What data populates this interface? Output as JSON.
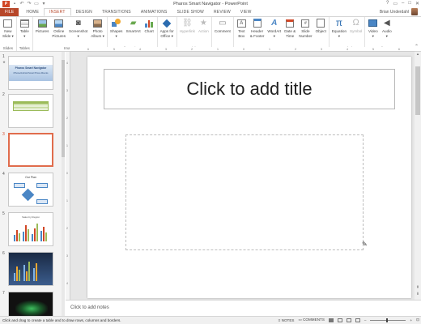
{
  "window": {
    "title": "Pharos Smart Navigator - PowerPoint",
    "app_icon": "P",
    "controls": [
      "?",
      "▭",
      "–",
      "□",
      "✕"
    ]
  },
  "qat": {
    "icons": [
      "save-icon",
      "undo-icon",
      "redo-icon",
      "start-slideshow-icon",
      "customize-qat-icon"
    ]
  },
  "tabs": [
    {
      "label": "FILE"
    },
    {
      "label": "HOME"
    },
    {
      "label": "INSERT"
    },
    {
      "label": "DESIGN"
    },
    {
      "label": "TRANSITIONS"
    },
    {
      "label": "ANIMATIONS"
    },
    {
      "label": "SLIDE SHOW"
    },
    {
      "label": "REVIEW"
    },
    {
      "label": "VIEW"
    }
  ],
  "active_tab": "INSERT",
  "user": {
    "name": "Brian Underdahl"
  },
  "ribbon": {
    "groups": [
      {
        "label": "Slides",
        "commands": [
          {
            "label": "New",
            "label2": "Slide ▾"
          }
        ]
      },
      {
        "label": "Tables",
        "commands": [
          {
            "label": "Table",
            "label2": "▾"
          }
        ]
      },
      {
        "label": "Images",
        "commands": [
          {
            "label": "Pictures",
            "label2": ""
          },
          {
            "label": "Online",
            "label2": "Pictures"
          },
          {
            "label": "Screenshot",
            "label2": "▾"
          },
          {
            "label": "Photo",
            "label2": "Album ▾"
          }
        ]
      },
      {
        "label": "Illustrations",
        "commands": [
          {
            "label": "Shapes",
            "label2": "▾"
          },
          {
            "label": "SmartArt",
            "label2": ""
          },
          {
            "label": "Chart",
            "label2": ""
          }
        ]
      },
      {
        "label": "Apps",
        "commands": [
          {
            "label": "Apps for",
            "label2": "Office ▾"
          }
        ]
      },
      {
        "label": "Links",
        "commands": [
          {
            "label": "Hyperlink",
            "label2": ""
          },
          {
            "label": "Action",
            "label2": ""
          }
        ]
      },
      {
        "label": "Comments",
        "commands": [
          {
            "label": "Comment",
            "label2": ""
          }
        ]
      },
      {
        "label": "Text",
        "commands": [
          {
            "label": "Text",
            "label2": "Box"
          },
          {
            "label": "Header",
            "label2": "& Footer"
          },
          {
            "label": "WordArt",
            "label2": "▾"
          },
          {
            "label": "Date &",
            "label2": "Time"
          },
          {
            "label": "Slide",
            "label2": "Number"
          },
          {
            "label": "Object",
            "label2": ""
          }
        ]
      },
      {
        "label": "Symbols",
        "commands": [
          {
            "label": "Equation",
            "label2": "▾"
          },
          {
            "label": "Symbol",
            "label2": ""
          }
        ]
      },
      {
        "label": "Media",
        "commands": [
          {
            "label": "Video",
            "label2": "▾"
          },
          {
            "label": "Audio",
            "label2": "▾"
          }
        ]
      }
    ]
  },
  "thumbnails": [
    {
      "num": "1",
      "star": "★",
      "title": "Pharos Smart Navigator",
      "subtitle": "iPhone/Android Smart Phone Mounts"
    },
    {
      "num": "2"
    },
    {
      "num": "3"
    },
    {
      "num": "4",
      "title": "Our Plan"
    },
    {
      "num": "5",
      "title": "Sales by Region"
    },
    {
      "num": "6"
    },
    {
      "num": "7"
    }
  ],
  "selected_slide": "3",
  "rulers": {
    "horizontal_ticks": [
      "6",
      "5",
      "4",
      "3",
      "2",
      "1",
      "0",
      "1",
      "2",
      "3",
      "4",
      "5",
      "6"
    ],
    "vertical_ticks": [
      "4",
      "3",
      "2",
      "1",
      "0",
      "1",
      "2",
      "3",
      "4"
    ]
  },
  "slide": {
    "title_placeholder": "Click to add title"
  },
  "notes": {
    "placeholder": "Click to add notes"
  },
  "status": {
    "message": "Click and drag to create a table and to draw rows, columns and borders.",
    "notes_label": "NOTES",
    "comments_label": "COMMENTS",
    "zoom_minus": "–",
    "zoom_plus": "+",
    "zoom_level": "100%"
  },
  "colors": {
    "accent": "#b7472a",
    "selected_thumb_border": "#e06c4c"
  }
}
